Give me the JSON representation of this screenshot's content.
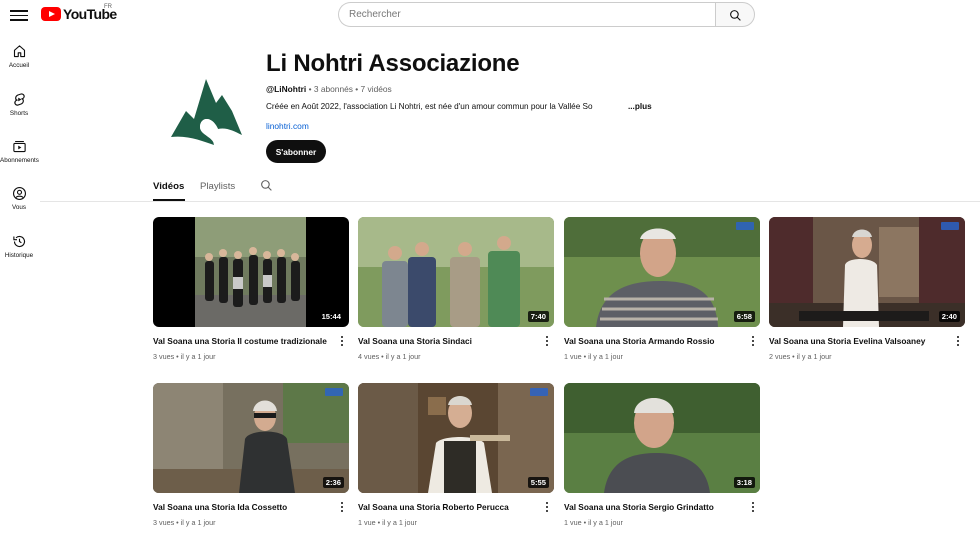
{
  "header": {
    "logo_text": "YouTube",
    "country_code": "FR",
    "search_placeholder": "Rechercher"
  },
  "sidebar": {
    "items": [
      {
        "label": "Accueil",
        "icon": "home-icon"
      },
      {
        "label": "Shorts",
        "icon": "shorts-icon"
      },
      {
        "label": "Abonnements",
        "icon": "subscriptions-icon"
      },
      {
        "label": "Vous",
        "icon": "you-icon"
      },
      {
        "label": "Historique",
        "icon": "history-icon"
      }
    ]
  },
  "channel": {
    "name": "Li Nohtri Associazione",
    "handle": "@LiNohtri",
    "stats": " • 3 abonnés • 7 vidéos",
    "description": "Créée en Août 2022, l'association Li Nohtri, est née d'un amour commun pour la Vallée So",
    "more_label": "...plus",
    "link": "linohtri.com",
    "subscribe_label": "S'abonner",
    "logo_color": "#1f5e47"
  },
  "tabs": [
    {
      "label": "Vidéos",
      "active": true
    },
    {
      "label": "Playlists",
      "active": false
    }
  ],
  "videos": [
    {
      "title": "Val Soana una Storia Il costume tradizionale",
      "duration": "15:44",
      "views": "3 vues",
      "age": "il y a 1 jour"
    },
    {
      "title": "Val Soana una Storia Sindaci",
      "duration": "7:40",
      "views": "4 vues",
      "age": "il y a 1 jour"
    },
    {
      "title": "Val Soana una Storia Armando Rossio",
      "duration": "6:58",
      "views": "1 vue",
      "age": "il y a 1 jour"
    },
    {
      "title": "Val Soana una Storia Evelina Valsoaney",
      "duration": "2:40",
      "views": "2 vues",
      "age": "il y a 1 jour"
    },
    {
      "title": "Val Soana una Storia Ida Cossetto",
      "duration": "2:36",
      "views": "3 vues",
      "age": "il y a 1 jour"
    },
    {
      "title": "Val Soana una Storia Roberto Perucca",
      "duration": "5:55",
      "views": "1 vue",
      "age": "il y a 1 jour"
    },
    {
      "title": "Val Soana una Storia Sergio Grindatto",
      "duration": "3:18",
      "views": "1 vue",
      "age": "il y a 1 jour"
    }
  ]
}
